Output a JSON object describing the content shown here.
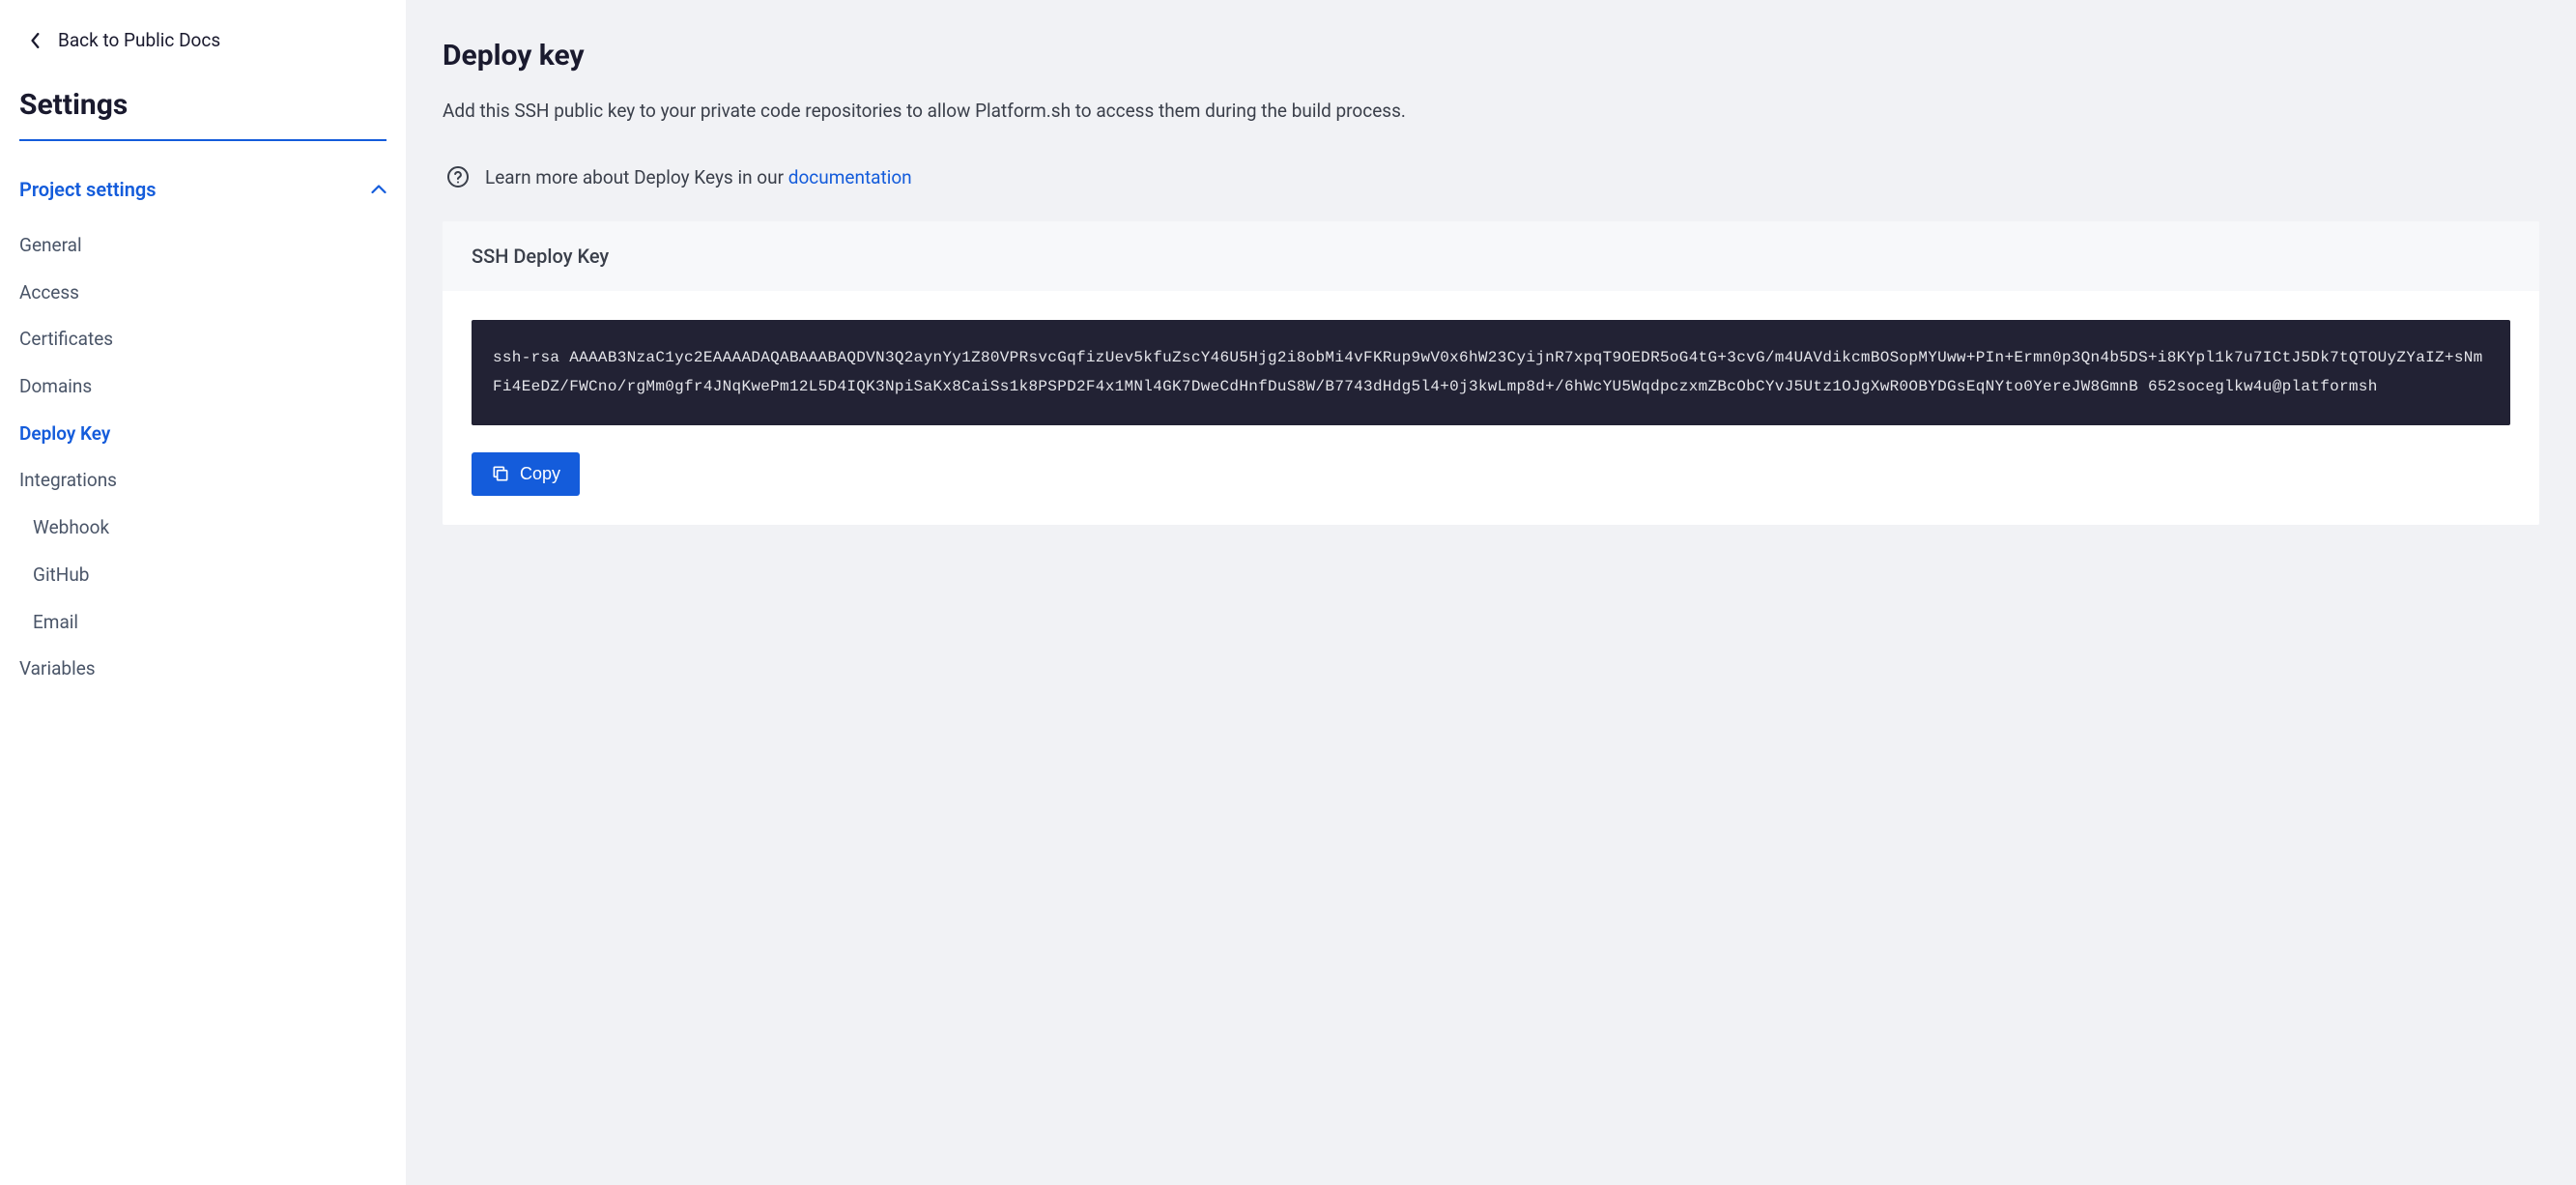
{
  "sidebar": {
    "back_label": "Back to Public Docs",
    "settings_title": "Settings",
    "section_title": "Project settings",
    "nav": {
      "general": "General",
      "access": "Access",
      "certificates": "Certificates",
      "domains": "Domains",
      "deploy_key": "Deploy Key",
      "integrations": "Integrations",
      "webhook": "Webhook",
      "github": "GitHub",
      "email": "Email",
      "variables": "Variables"
    }
  },
  "main": {
    "title": "Deploy key",
    "description": "Add this SSH public key to your private code repositories to allow Platform.sh to access them during the build process.",
    "help_prefix": "Learn more about Deploy Keys in our ",
    "help_link": "documentation",
    "card_title": "SSH Deploy Key",
    "ssh_key": "ssh-rsa AAAAB3NzaC1yc2EAAAADAQABAAABAQDVN3Q2aynYy1Z80VPRsvcGqfizUev5kfuZscY46U5Hjg2i8obMi4vFKRup9wV0x6hW23CyijnR7xpqT9OEDR5oG4tG+3cvG/m4UAVdikcmBOSopMYUww+PIn+Ermn0p3Qn4b5DS+i8KYpl1k7u7ICtJ5Dk7tQTOUyZYaIZ+sNmFi4EeDZ/FWCno/rgMm0gfr4JNqKwePm12L5D4IQK3NpiSaKx8CaiSs1k8PSPD2F4x1MNl4GK7DweCdHnfDuS8W/B7743dHdg5l4+0j3kwLmp8d+/6hWcYU5WqdpczxmZBcObCYvJ5Utz1OJgXwR0OBYDGsEqNYto0YereJW8GmnB 652soceglkw4u@platformsh",
    "copy_label": "Copy"
  }
}
